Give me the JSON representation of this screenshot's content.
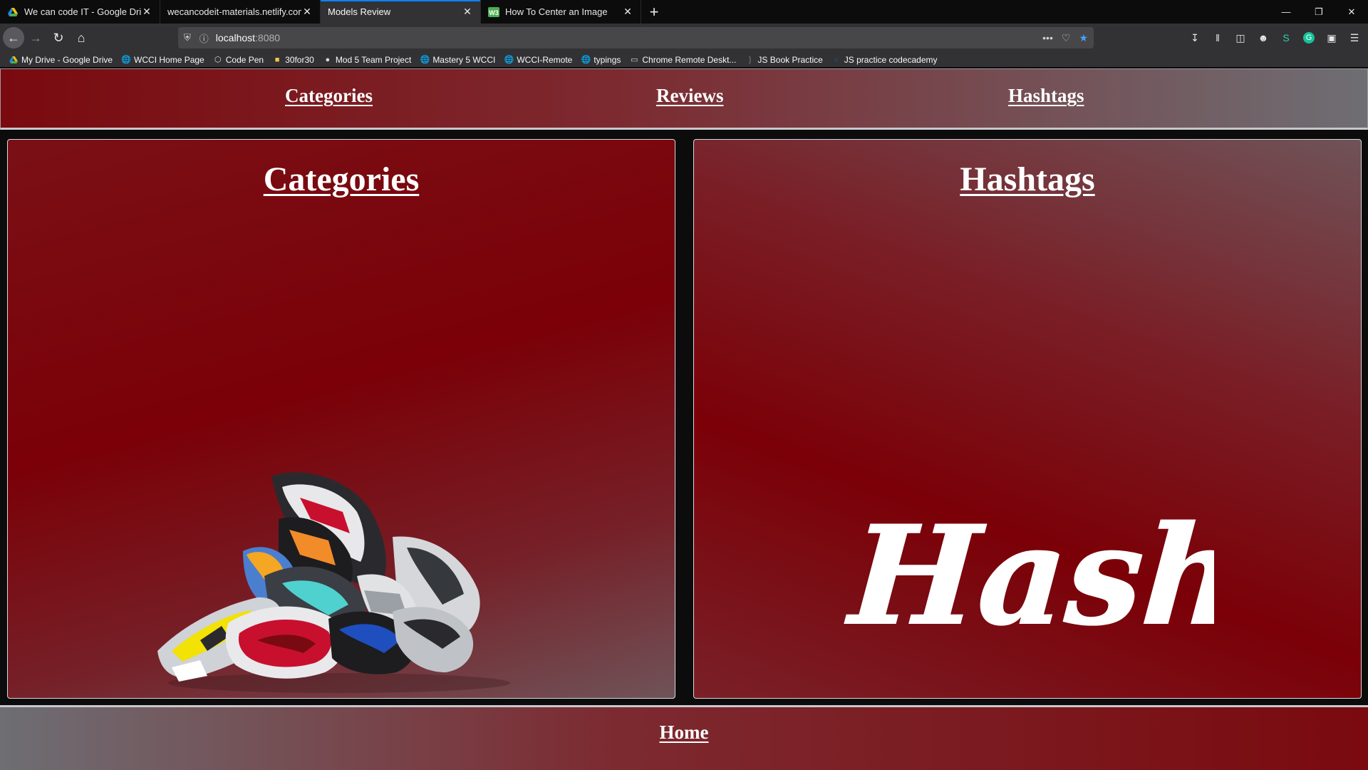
{
  "browser": {
    "tabs": [
      {
        "title": "We can code IT - Google Drive",
        "icon": "google-drive-icon",
        "active": false
      },
      {
        "title": "wecancodeit-materials.netlify.com/",
        "icon": "none",
        "active": false
      },
      {
        "title": "Models Review",
        "icon": "none",
        "active": true
      },
      {
        "title": "How To Center an Image",
        "icon": "w3schools-icon",
        "active": false
      }
    ],
    "close_glyph": "✕",
    "new_tab_glyph": "+",
    "url": {
      "host": "localhost",
      "port": ":8080"
    },
    "bookmarks": [
      {
        "label": "My Drive - Google Drive",
        "icon": "google-drive-icon"
      },
      {
        "label": "WCCI Home Page",
        "icon": "globe-icon"
      },
      {
        "label": "Code Pen",
        "icon": "codepen-icon"
      },
      {
        "label": "30for30",
        "icon": "folder-icon"
      },
      {
        "label": "Mod 5 Team Project",
        "icon": "github-icon"
      },
      {
        "label": "Mastery 5 WCCI",
        "icon": "globe-icon"
      },
      {
        "label": "WCCI-Remote",
        "icon": "globe-icon"
      },
      {
        "label": "typings",
        "icon": "globe-icon"
      },
      {
        "label": "Chrome Remote Deskt...",
        "icon": "chrome-remote-icon"
      },
      {
        "label": "JS Book Practice",
        "icon": "page-icon"
      },
      {
        "label": "JS practice codecademy",
        "icon": "codecademy-icon"
      }
    ],
    "accent": "#0a84ff"
  },
  "page": {
    "nav": {
      "categories": "Categories",
      "reviews": "Reviews",
      "hashtags": "Hashtags"
    },
    "panels": {
      "categories": {
        "title": "Categories",
        "image": "sneaker-pile-image"
      },
      "hashtags": {
        "title": "Hashtags",
        "image": "hashtag-script-image",
        "image_text": "Hashtag"
      }
    },
    "footer": {
      "home": "Home"
    },
    "colors": {
      "maroon": "#7b0007",
      "gray": "#6e6e73"
    }
  }
}
